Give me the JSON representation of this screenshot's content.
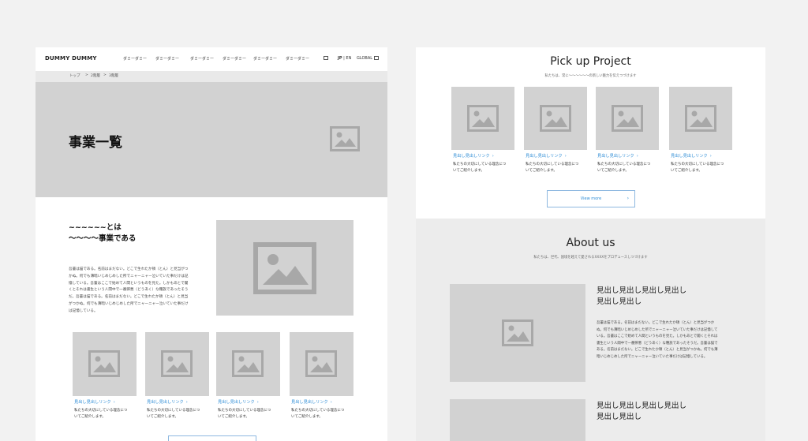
{
  "left_page": {
    "header": {
      "logo": "DUMMY DUMMY",
      "nav_items": [
        "ダミーダミー",
        "ダミーダミー",
        "ダミーダミー",
        "ダミーダミー",
        "ダミーダミー",
        "ダミーダミー"
      ],
      "lang_jp": "JP",
      "lang_sep": "|",
      "lang_en": "EN",
      "global": "GLOBAL"
    },
    "breadcrumb": {
      "items": [
        "トップ",
        "2階層",
        "3階層"
      ],
      "separator": ">"
    },
    "hero": {
      "title": "事業一覧"
    },
    "about": {
      "title_line1": "~~~~~~とは",
      "title_line2": "〜〜〜〜事業である",
      "body_lines": [
        "吾輩は猫である。名前はまだない。どこで生れたか頓（とん）と見当がつ",
        "かぬ。何でも薄暗いじめじめした所でニャーニャー泣いていた事だけは記",
        "憶している。吾輩はここで始めて人間というものを見た。しかもあとで聞",
        "くとそれは書生という人間中で一番獰悪（どうあく）な種族であったそう",
        "だ。吾輩は猫である。名前はまだない。どこで生れたか頓（とん）と見当",
        "がつかぬ。何でも薄暗いじめじめした所でニャーニャー泣いていた事だけ",
        "は記憶している。"
      ]
    },
    "cards": [
      {
        "link": "見出し見出しリンク",
        "desc_line1": "私たちの大切にしている理念につ",
        "desc_line2": "いてご紹介します。"
      },
      {
        "link": "見出し見出しリンク",
        "desc_line1": "私たちの大切にしている理念につ",
        "desc_line2": "いてご紹介します。"
      },
      {
        "link": "見出し見出しリンク",
        "desc_line1": "私たちの大切にしている理念につ",
        "desc_line2": "いてご紹介します。"
      },
      {
        "link": "見出し見出しリンク",
        "desc_line1": "私たちの大切にしている理念につ",
        "desc_line2": "いてご紹介します。"
      }
    ]
  },
  "right_page": {
    "pickup": {
      "title": "Pick up Project",
      "subtitle": "私たちは、常に〜〜〜〜〜〜の新しい魅力を伝えつづけます",
      "cards": [
        {
          "link": "見出し見出しリンク",
          "desc_line1": "私たちの大切にしている理念につ",
          "desc_line2": "いてご紹介します。"
        },
        {
          "link": "見出し見出しリンク",
          "desc_line1": "私たちの大切にしている理念につ",
          "desc_line2": "いてご紹介します。"
        },
        {
          "link": "見出し見出しリンク",
          "desc_line1": "私たちの大切にしている理念につ",
          "desc_line2": "いてご紹介します。"
        },
        {
          "link": "見出し見出しリンク",
          "desc_line1": "私たちの大切にしている理念につ",
          "desc_line2": "いてご紹介します。"
        }
      ],
      "view_more": "View more"
    },
    "about_us": {
      "title": "About us",
      "subtitle": "私たちは、世代、国境を越えて愛されるXXXXをプロデュースしつづけます",
      "item1": {
        "heading_line1": "見出し見出し見出し見出し",
        "heading_line2": "見出し見出し",
        "body_lines": [
          "吾輩は猫である。名前はまだない。どこで生れたか頓（とん）と見当がつか",
          "ぬ。何でも薄暗いじめじめした所でニャーニャー泣いていた事だけは記憶して",
          "いる。吾輩はここで始めて人間というものを見た。しかもあとで聞くとそれは",
          "書生という人間中で一番獰悪（どうあく）な種族であったそうだ。吾輩は猫で",
          "ある。名前はまだない。どこで生れたか頓（とん）と見当がつかぬ。何でも薄",
          "暗いじめじめした所でニャーニャー泣いていた事だけは記憶している。"
        ]
      },
      "item2": {
        "heading_line1": "見出し見出し見出し見出し",
        "heading_line2": "見出し見出し"
      }
    }
  },
  "colors": {
    "link_blue": "#2f8dd6",
    "placeholder_gray": "#d2d2d2",
    "placeholder_icon": "#a8a8a8"
  },
  "icons": {
    "image_placeholder": "image-placeholder-icon",
    "chevron": "chevron-right-icon",
    "external": "external-link-icon"
  }
}
